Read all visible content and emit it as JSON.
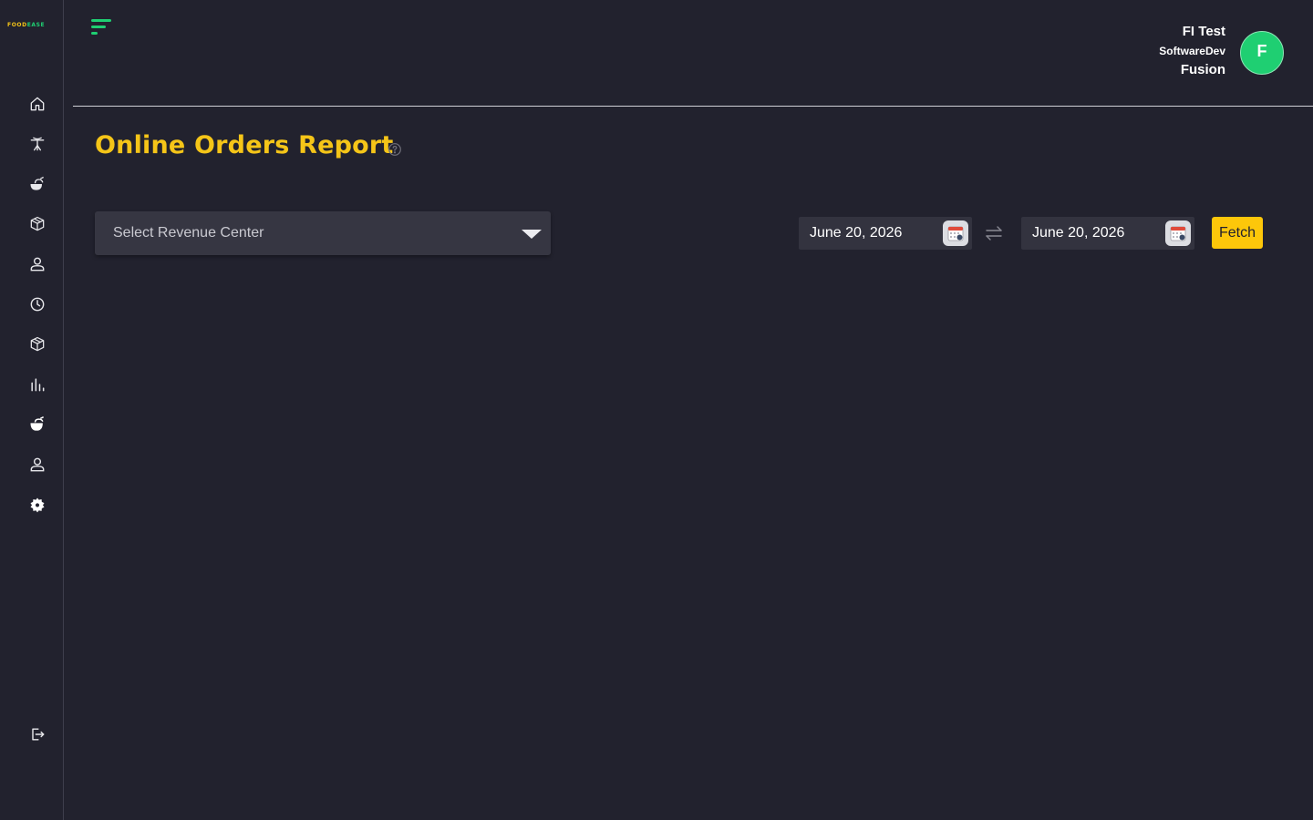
{
  "brand": {
    "logo_part1": "FOOD",
    "logo_part2": "EASE"
  },
  "sidebar": {
    "items": [
      {
        "name": "home-icon"
      },
      {
        "name": "dining-table-icon"
      },
      {
        "name": "food-icon"
      },
      {
        "name": "box-icon"
      },
      {
        "name": "user-icon"
      },
      {
        "name": "clock-icon"
      },
      {
        "name": "package-icon"
      },
      {
        "name": "bar-chart-icon"
      },
      {
        "name": "food-solid-icon"
      },
      {
        "name": "person-icon"
      },
      {
        "name": "gear-icon"
      }
    ],
    "logout_icon": "logout-icon"
  },
  "user": {
    "name": "FI Test",
    "role": "SoftwareDev",
    "company": "Fusion",
    "avatar_letter": "F"
  },
  "page": {
    "title": "Online Orders Report"
  },
  "filters": {
    "revenue_center_placeholder": "Select Revenue Center",
    "start_date": "June 20, 2026",
    "end_date": "June 20, 2026",
    "fetch_label": "Fetch"
  },
  "colors": {
    "background": "#22222e",
    "accent_yellow": "#f5c518",
    "accent_green": "#1fcf72",
    "button_yellow": "#fdc70a"
  }
}
